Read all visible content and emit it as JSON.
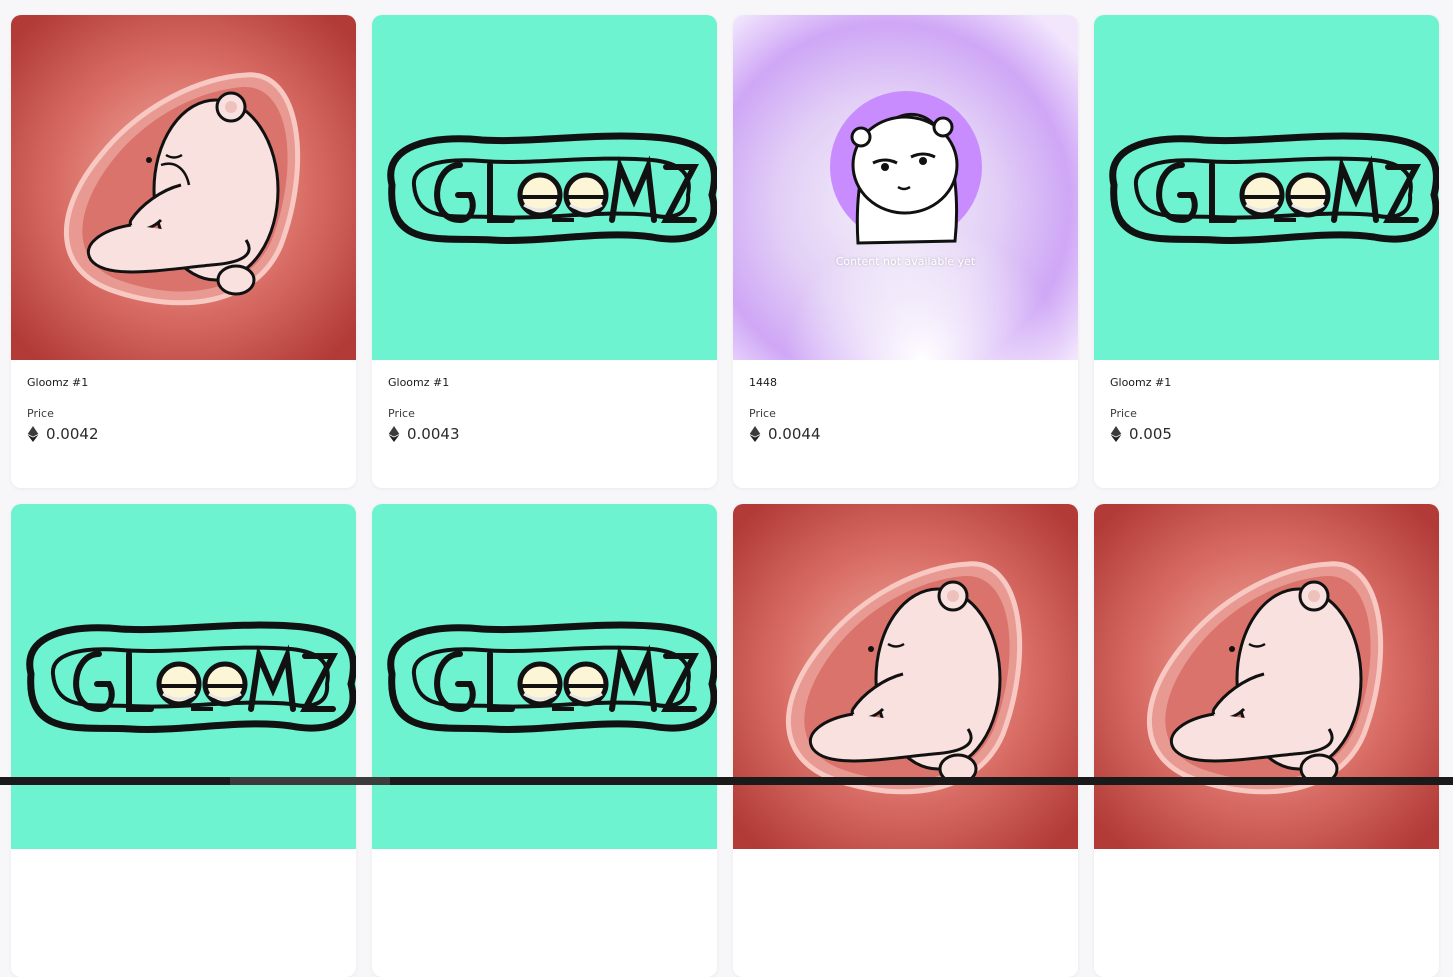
{
  "currency_icon": "ethereum-icon",
  "price_label": "Price",
  "placeholder": {
    "text": "Content not available yet"
  },
  "colors": {
    "mint": "#6ef3d1",
    "embryo_red": "#c9514c",
    "lilac": "#c58cff"
  },
  "items": [
    {
      "title": "Gloomz #1",
      "price": "0.0042",
      "art": "embryo"
    },
    {
      "title": "Gloomz #1",
      "price": "0.0043",
      "art": "logo"
    },
    {
      "title": "1448",
      "price": "0.0044",
      "art": "placeholder"
    },
    {
      "title": "Gloomz #1",
      "price": "0.005",
      "art": "logo"
    },
    {
      "title": "",
      "price": "",
      "art": "logo"
    },
    {
      "title": "",
      "price": "",
      "art": "logo"
    },
    {
      "title": "",
      "price": "",
      "art": "embryo"
    },
    {
      "title": "",
      "price": "",
      "art": "embryo"
    }
  ]
}
